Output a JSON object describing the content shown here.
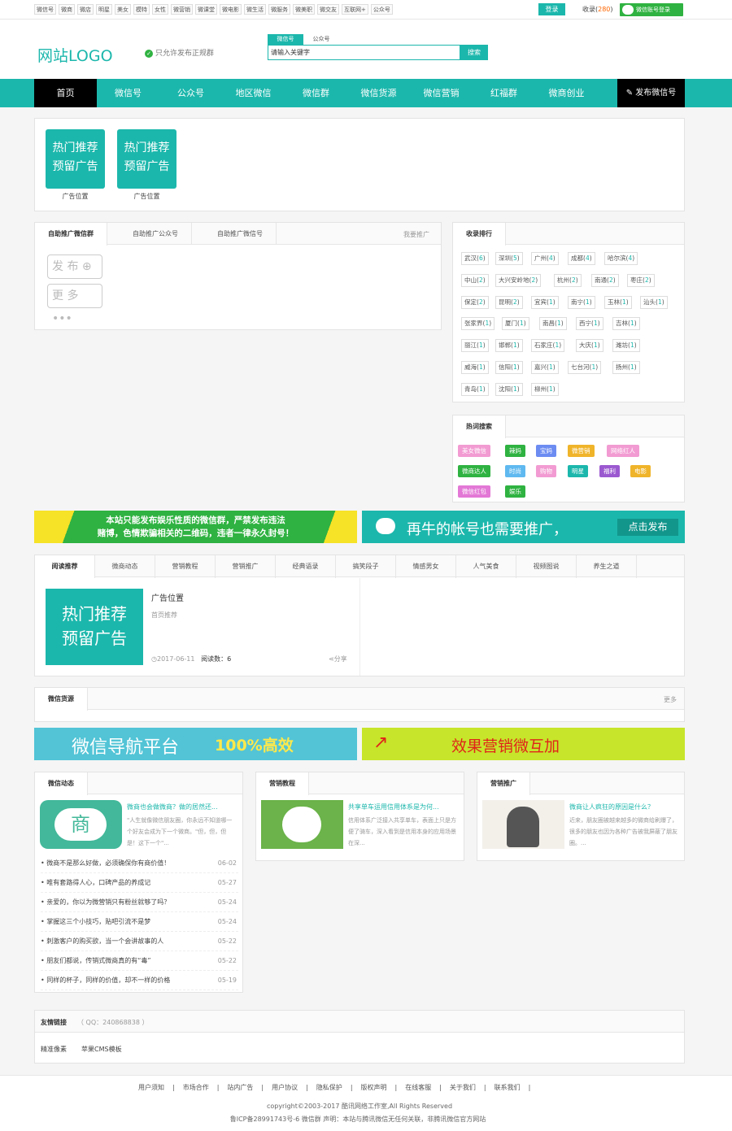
{
  "topbar": {
    "links": [
      "微信号",
      "微商",
      "微店",
      "明星",
      "美女",
      "模特",
      "女性",
      "微营销",
      "微课堂",
      "微电影",
      "微生活",
      "微服务",
      "微美职",
      "微交友",
      "互联网+",
      "公众号"
    ],
    "login": "登录",
    "fav_label": "收录(",
    "fav_count": "280",
    "fav_end": ")",
    "wx_login": "微信账号登录"
  },
  "header": {
    "logo": "网站LOGO",
    "note": "只允许发布正规群",
    "search_tabs": [
      "微信号",
      "公众号"
    ],
    "search_placeholder": "请输入关键字",
    "search_btn": "搜索"
  },
  "nav": {
    "items": [
      "首页",
      "微信号",
      "公众号",
      "地区微信",
      "微信群",
      "微信货源",
      "微信营销",
      "红福群",
      "微商创业"
    ],
    "publish": "发布微信号"
  },
  "ads": {
    "tile": [
      "热门推荐",
      "预留广告"
    ],
    "caption": "广告位置"
  },
  "selfpromo": {
    "tabs": [
      "自助推广微信群",
      "自助推广公众号",
      "自助推广微信号"
    ],
    "right": "我要推广",
    "btn_publish": "发 布",
    "btn_more": "更 多"
  },
  "ranking": {
    "title": "收录排行",
    "cities": [
      [
        "武汉",
        "6"
      ],
      [
        "深圳",
        "5"
      ],
      [
        "广州",
        "4"
      ],
      [
        "成都",
        "4"
      ],
      [
        "哈尔滨",
        "4"
      ],
      [
        "中山",
        "2"
      ],
      [
        "大兴安岭地",
        "2"
      ],
      [
        "杭州",
        "2"
      ],
      [
        "南通",
        "2"
      ],
      [
        "枣庄",
        "2"
      ],
      [
        "保定",
        "2"
      ],
      [
        "昆明",
        "2"
      ],
      [
        "宜宾",
        "1"
      ],
      [
        "南宁",
        "1"
      ],
      [
        "玉林",
        "1"
      ],
      [
        "汕头",
        "1"
      ],
      [
        "张家界",
        "1"
      ],
      [
        "厦门",
        "1"
      ],
      [
        "南昌",
        "1"
      ],
      [
        "西宁",
        "1"
      ],
      [
        "吉林",
        "1"
      ],
      [
        "丽江",
        "1"
      ],
      [
        "邯郸",
        "1"
      ],
      [
        "石家庄",
        "1"
      ],
      [
        "大庆",
        "1"
      ],
      [
        "潍坊",
        "1"
      ],
      [
        "威海",
        "1"
      ],
      [
        "信阳",
        "1"
      ],
      [
        "嘉兴",
        "1"
      ],
      [
        "七台河",
        "1"
      ],
      [
        "扬州",
        "1"
      ],
      [
        "青岛",
        "1"
      ],
      [
        "沈阳",
        "1"
      ],
      [
        "柳州",
        "1"
      ]
    ]
  },
  "hot": {
    "title": "热词搜索",
    "tags": [
      [
        "美女微信",
        "#f29bd2"
      ],
      [
        "辣妈",
        "#2fb241"
      ],
      [
        "宝妈",
        "#6d8cf2"
      ],
      [
        "微营销",
        "#f0b42a"
      ],
      [
        "网络红人",
        "#f29bd2"
      ],
      [
        "微商达人",
        "#2fb241"
      ],
      [
        "时尚",
        "#5fb9f0"
      ],
      [
        "购物",
        "#f29bd2"
      ],
      [
        "明星",
        "#1cb7ac"
      ],
      [
        "福利",
        "#9b59d0"
      ],
      [
        "电影",
        "#f0b42a"
      ],
      [
        "微信红包",
        "#e378d6"
      ],
      [
        "娱乐",
        "#2fb241"
      ]
    ]
  },
  "banner1": {
    "line1": "本站只能发布娱乐性质的微信群，严禁发布违法",
    "line2": "赌博，色情欺骗相关的二维码，违者一律永久封号！"
  },
  "banner2": {
    "text": "再牛的帐号也需要推广，",
    "btn": "点击发布"
  },
  "read": {
    "tabs": [
      "阅读推荐",
      "微商动态",
      "营销教程",
      "营销推广",
      "经典语录",
      "搞笑段子",
      "情感男女",
      "人气美食",
      "视频图说",
      "养生之道"
    ],
    "title": "广告位置",
    "sub": "首页推荐",
    "date": "2017-06-11",
    "reads_label": "阅读数：",
    "reads": "6",
    "share": "分享"
  },
  "goods": {
    "title": "微信货源",
    "more": "更多"
  },
  "banner3": {
    "text": "微信导航平台",
    "accent": "100%高效"
  },
  "banner4": {
    "text": "效果营销微互加"
  },
  "dynamics": {
    "title": "微信动态",
    "lead_title": "微商也会做微商？做的居然还...",
    "lead_text": "\"人生就像微信朋友圈，你永远不知道哪一个好友会成为下一个微商。\"但，但，但是！这下一个\"...",
    "img_text": "商",
    "list": [
      [
        "微商不是那么好做，必须确保你有商价值！",
        "06-02"
      ],
      [
        "唯有套路得人心，口碑产品的养成记",
        "05-27"
      ],
      [
        "亲爱的，你以为微营销只有粉丝就够了吗？",
        "05-24"
      ],
      [
        "掌握这三个小技巧，贴吧引流不是梦",
        "05-24"
      ],
      [
        "刺激客户的购买欲，当一个会讲故事的人",
        "05-22"
      ],
      [
        "朋友们都说，传销式微商真的有“毒”",
        "05-22"
      ],
      [
        "同样的杯子，同样的价值，却不一样的价格",
        "05-19"
      ]
    ]
  },
  "tutorial": {
    "title": "营销教程",
    "lead_title": "共享单车运用信用体系是为何...",
    "lead_text": "信用体系广泛接入共享单车，表面上只是方便了骑车，深入看到是信用本身的应用场景在深..."
  },
  "promo": {
    "title": "营销推广",
    "lead_title": "微商让人疯狂的原因是什么？",
    "lead_text": "近来，朋友圈被越来越多的微商给刷爆了，很多的朋友也因为各种广告被我屏蔽了朋友圈。..."
  },
  "links": {
    "title": "友情链接",
    "qq": "（ QQ：240868838 ）",
    "items": [
      "精准像素",
      "苹果CMS模板"
    ]
  },
  "footer": {
    "links": [
      "用户须知",
      "市场合作",
      "站内广告",
      "用户协议",
      "隐私保护",
      "版权声明",
      "在线客服",
      "关于我们",
      "联系我们"
    ],
    "copyright": "copyright©2003-2017 酷讯网络工作室,All Rights Reserved",
    "icp": "鲁ICP备28991743号-6 微信群   声明：本站与腾讯微信无任何关联，非腾讯微信官方网站"
  }
}
